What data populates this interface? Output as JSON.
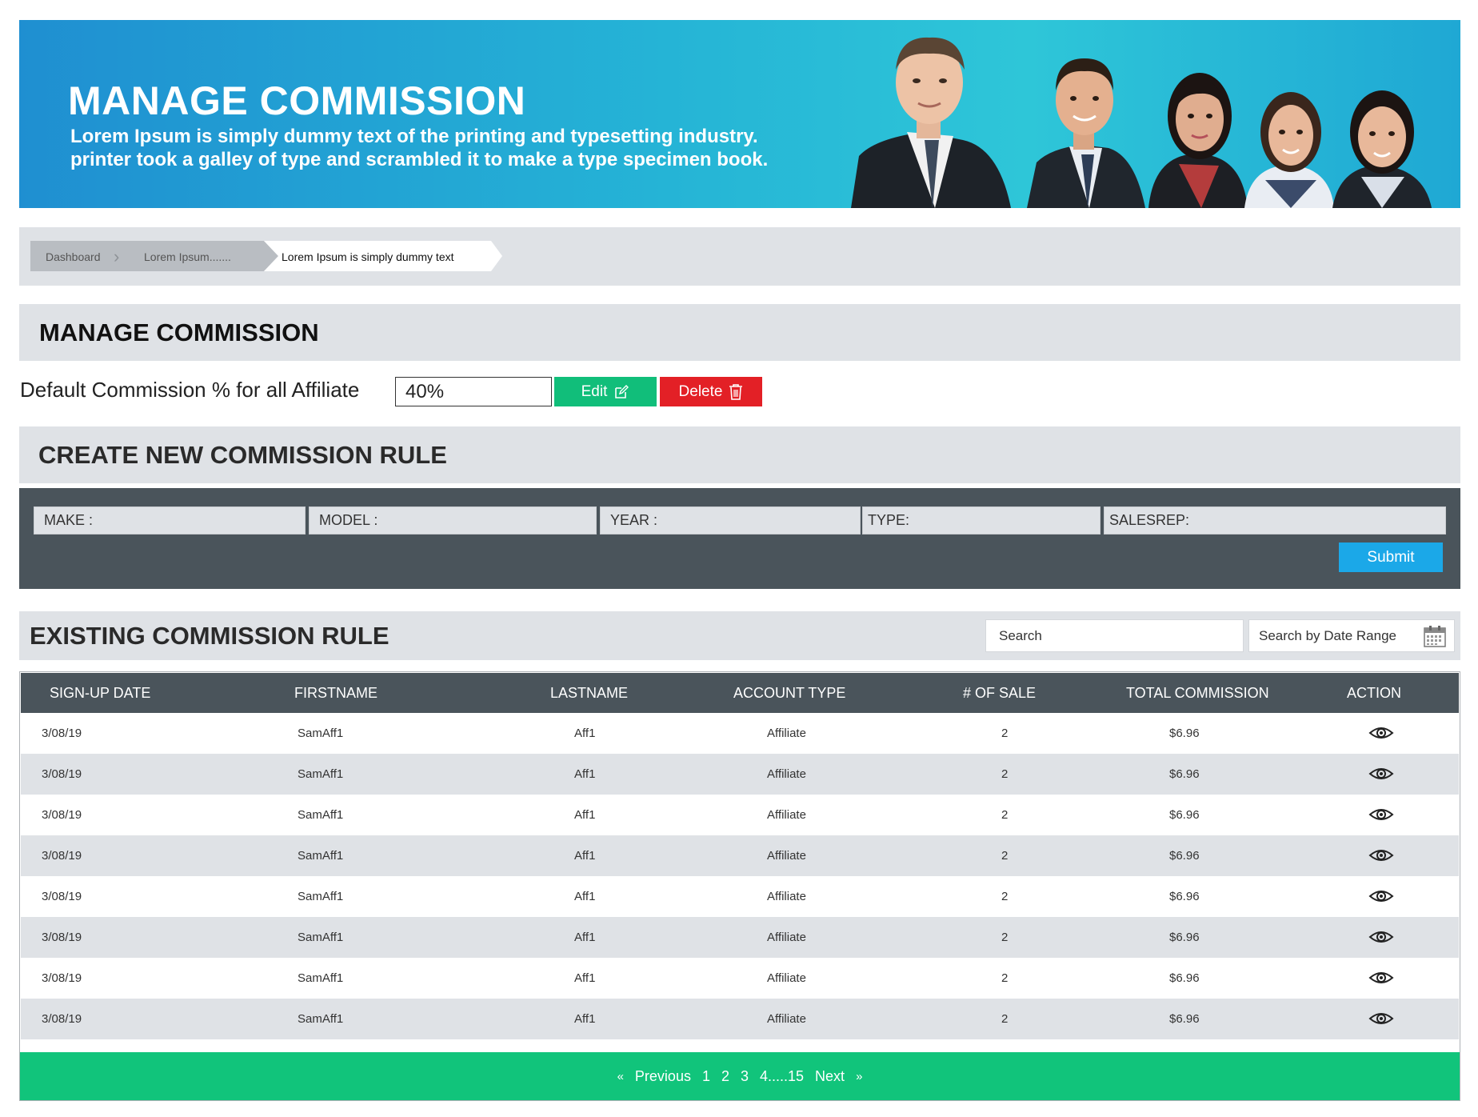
{
  "banner": {
    "title": "MANAGE COMMISSION",
    "subtitle_line1": "Lorem Ipsum is simply dummy text of the printing and typesetting industry.",
    "subtitle_line2": "printer took a galley of type and scrambled it to make a type specimen book."
  },
  "breadcrumb": {
    "items": [
      "Dashboard",
      "Lorem Ipsum.......",
      "Lorem Ipsum is simply dummy text"
    ]
  },
  "manage": {
    "title": "MANAGE COMMISSION",
    "default_label": "Default Commission % for all Affiliate",
    "default_value": "40%",
    "edit_label": "Edit",
    "delete_label": "Delete"
  },
  "create": {
    "title": "CREATE NEW COMMISSION RULE",
    "fields": [
      "MAKE :",
      "MODEL :",
      "YEAR :",
      "TYPE:",
      "SALESREP:"
    ],
    "submit_label": "Submit"
  },
  "existing": {
    "title": "EXISTING COMMISSION RULE",
    "search_placeholder": "Search",
    "date_range_placeholder": "Search by Date Range"
  },
  "table": {
    "headers": [
      "SIGN-UP DATE",
      "FIRSTNAME",
      "LASTNAME",
      "ACCOUNT TYPE",
      "# OF SALE",
      "TOTAL COMMISSION",
      "ACTION"
    ],
    "rows": [
      [
        "3/08/19",
        "SamAff1",
        "Aff1",
        "Affiliate",
        "2",
        "$6.96"
      ],
      [
        "3/08/19",
        "SamAff1",
        "Aff1",
        "Affiliate",
        "2",
        "$6.96"
      ],
      [
        "3/08/19",
        "SamAff1",
        "Aff1",
        "Affiliate",
        "2",
        "$6.96"
      ],
      [
        "3/08/19",
        "SamAff1",
        "Aff1",
        "Affiliate",
        "2",
        "$6.96"
      ],
      [
        "3/08/19",
        "SamAff1",
        "Aff1",
        "Affiliate",
        "2",
        "$6.96"
      ],
      [
        "3/08/19",
        "SamAff1",
        "Aff1",
        "Affiliate",
        "2",
        "$6.96"
      ],
      [
        "3/08/19",
        "SamAff1",
        "Aff1",
        "Affiliate",
        "2",
        "$6.96"
      ],
      [
        "3/08/19",
        "SamAff1",
        "Aff1",
        "Affiliate",
        "2",
        "$6.96"
      ]
    ]
  },
  "pagination": {
    "first": "«",
    "previous": "Previous",
    "pages": [
      "1",
      "2",
      "3",
      "4.....15"
    ],
    "next": "Next",
    "last": "»"
  },
  "colors": {
    "banner_start": "#1f8fd1",
    "banner_end": "#2ec6d8",
    "section_bg": "#dfe2e6",
    "dark_panel": "#4a545b",
    "edit_green": "#11be7a",
    "delete_red": "#e32026",
    "submit_blue": "#1ba8e8",
    "pager_green": "#11c47b"
  }
}
